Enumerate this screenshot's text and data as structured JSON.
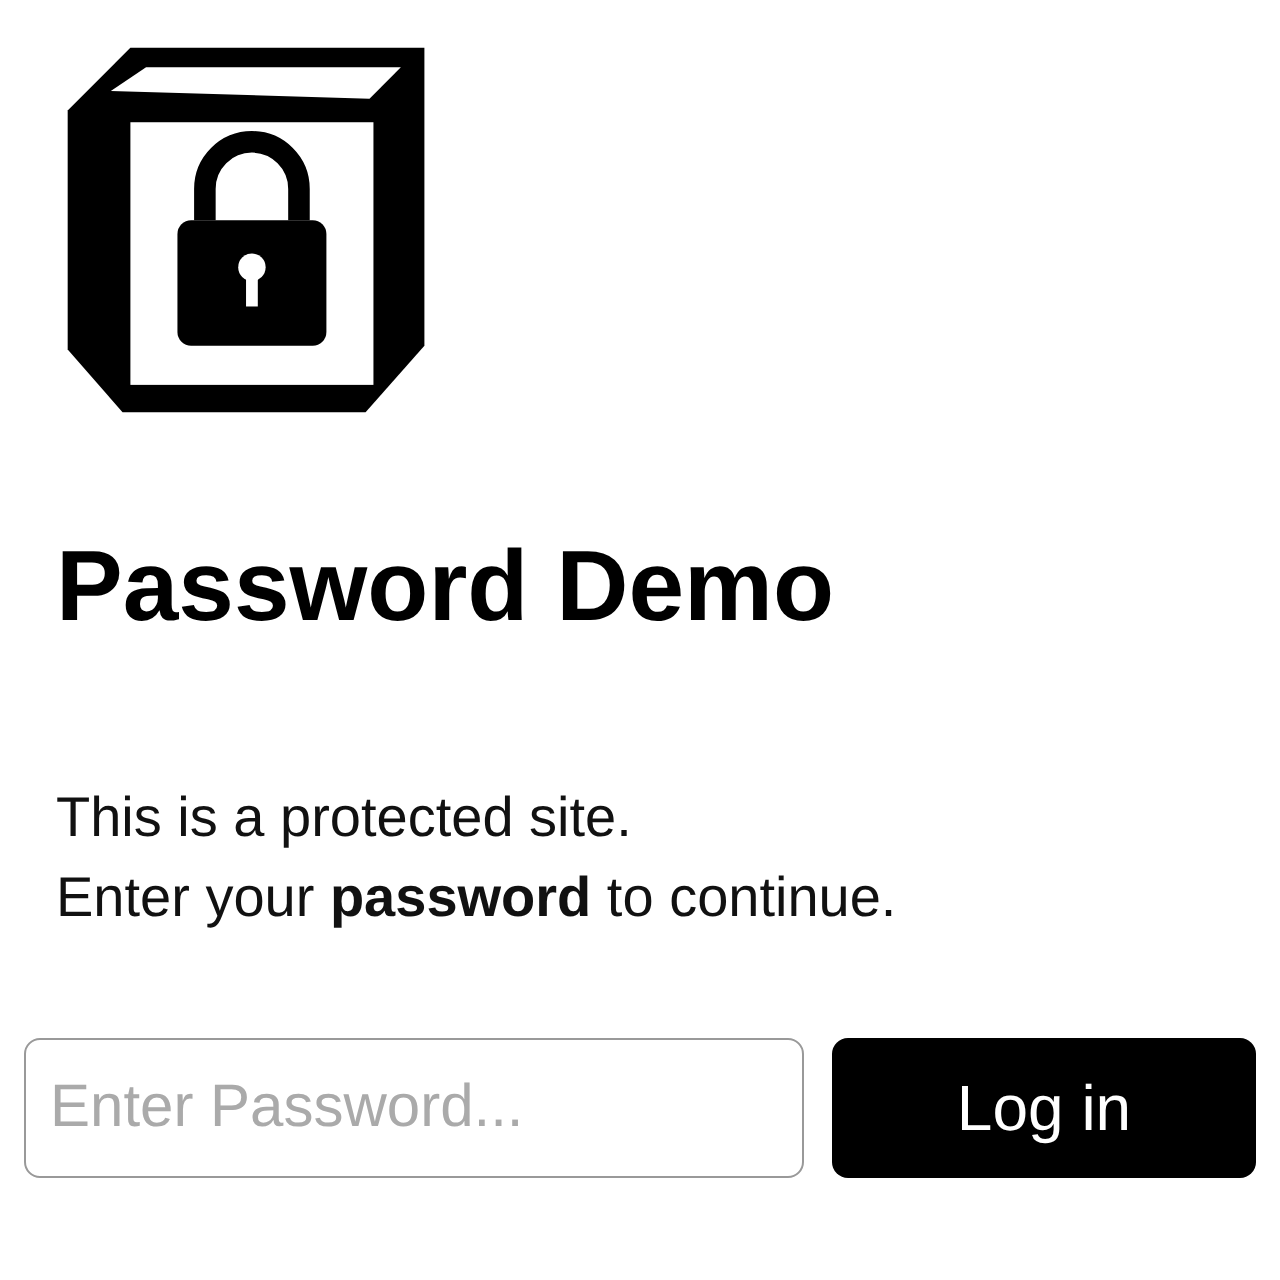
{
  "title": "Password Demo",
  "intro": [
    "This is a protected site.",
    "Enter your **password** to continue."
  ],
  "password_field": {
    "placeholder": "Enter Password..."
  },
  "login_button": {
    "label": "Log in"
  }
}
